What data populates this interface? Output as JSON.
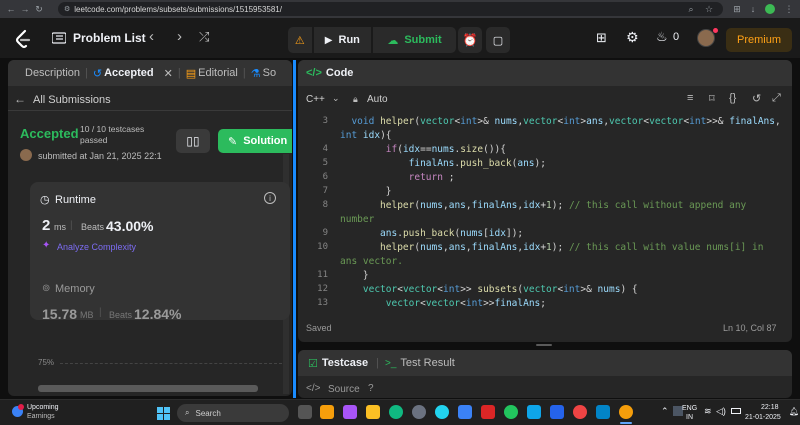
{
  "browser": {
    "url": "leetcode.com/problems/subsets/submissions/1515953581/"
  },
  "topnav": {
    "problem_list": "Problem List",
    "run": "Run",
    "submit": "Submit",
    "fire_count": "0",
    "premium": "Premium"
  },
  "left": {
    "tabs": [
      "Description",
      "Accepted",
      "Editorial",
      "So"
    ],
    "all_submissions": "All Submissions",
    "status": "Accepted",
    "testcases": "10 / 10 testcases",
    "passed": "passed",
    "submitted": "submitted at Jan 21, 2025 22:1",
    "solution_button": "Solution",
    "runtime_label": "Runtime",
    "runtime_value": "2",
    "runtime_unit": "ms",
    "beats_label": "Beats",
    "runtime_beats": "43.00%",
    "analyze": "Analyze Complexity",
    "memory_label": "Memory",
    "memory_value": "15.78",
    "memory_unit": "MB",
    "memory_beats": "12.84%",
    "chart_pct": "75%"
  },
  "editor": {
    "title": "Code",
    "language": "C++",
    "mode": "Auto",
    "saved": "Saved",
    "cursor": "Ln 10, Col 87"
  },
  "code_lines": [
    {
      "n": "3"
    },
    {
      "n": ""
    },
    {
      "n": "4"
    },
    {
      "n": "5"
    },
    {
      "n": "6"
    },
    {
      "n": "7"
    },
    {
      "n": "8"
    },
    {
      "n": ""
    },
    {
      "n": "9"
    },
    {
      "n": "10"
    },
    {
      "n": ""
    },
    {
      "n": "11"
    },
    {
      "n": "12"
    },
    {
      "n": "13"
    }
  ],
  "bottom": {
    "testcase": "Testcase",
    "test_result": "Test Result",
    "source": "Source"
  },
  "taskbar": {
    "weather_title": "Upcoming",
    "weather_sub": "Earnings",
    "search": "Search",
    "lang1": "ENG",
    "lang2": "IN",
    "time": "22:18",
    "date": "21-01-2025"
  }
}
